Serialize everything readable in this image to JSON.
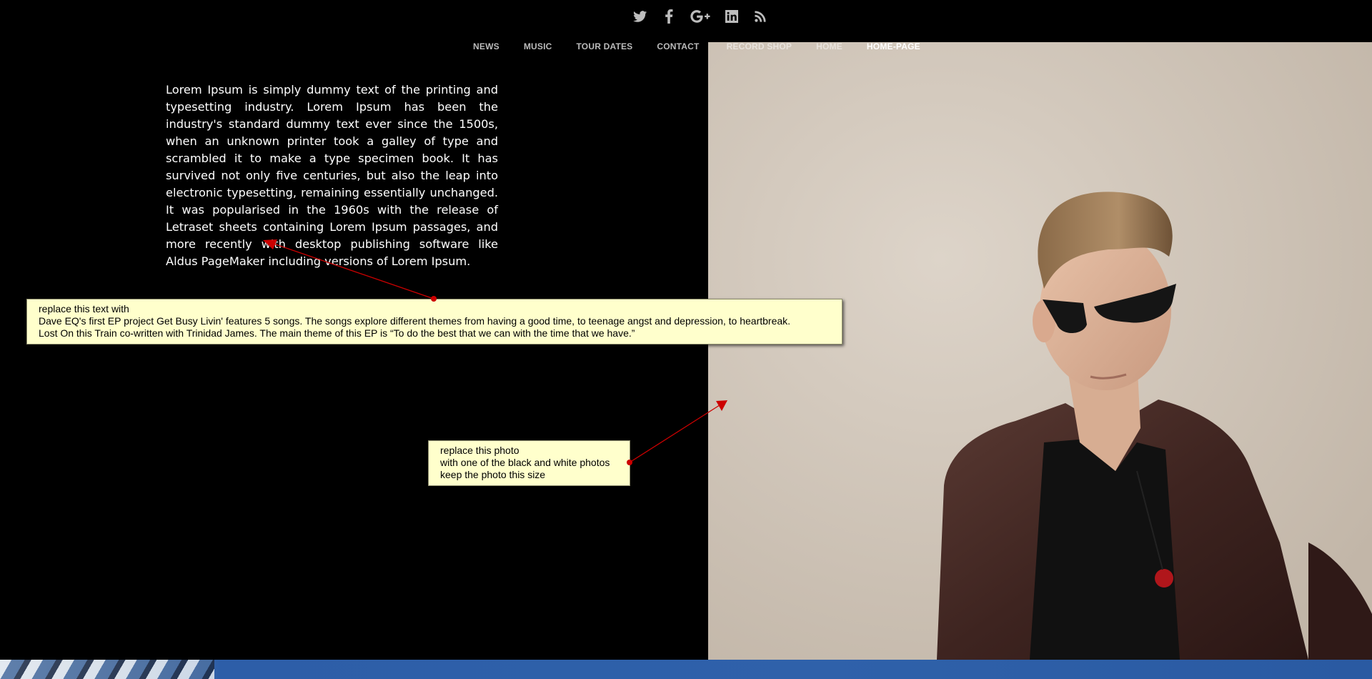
{
  "social": {
    "icons": [
      "twitter-icon",
      "facebook-icon",
      "google-plus-icon",
      "linkedin-icon",
      "rss-icon"
    ]
  },
  "nav": {
    "items": [
      {
        "label": "NEWS"
      },
      {
        "label": "MUSIC"
      },
      {
        "label": "TOUR DATES"
      },
      {
        "label": "CONTACT"
      },
      {
        "label": "RECORD SHOP"
      },
      {
        "label": "HOME"
      },
      {
        "label": "HOME-PAGE"
      }
    ]
  },
  "content": {
    "body_text": "Lorem Ipsum is simply dummy text of the printing and typesetting industry. Lorem Ipsum has been the industry's standard dummy text ever since the 1500s, when an unknown printer took a galley of type and scrambled it to make a type specimen book. It has survived not only five centuries, but also the leap into electronic typesetting, remaining essentially unchanged. It was popularised in the 1960s with the release of Letraset sheets containing Lorem Ipsum passages, and more recently with desktop publishing software like Aldus PageMaker including versions of Lorem Ipsum."
  },
  "annotations": {
    "text_note": {
      "line1": "replace this text with",
      "line2": "Dave EQ's first EP project Get Busy Livin' features 5 songs. The songs explore different themes from having a good time, to teenage angst and depression, to heartbreak.",
      "line3": "Lost On this Train co-written with Trinidad James. The main theme of this EP is “To do the best that we can with the time that we have.”"
    },
    "photo_note": {
      "line1": "replace this photo",
      "line2": "with one of the black and white photos",
      "line3": "keep the photo this size"
    }
  },
  "colors": {
    "background": "#000000",
    "note_background": "#ffffcc",
    "arrow": "#cc0000",
    "photo_backdrop": "#d4cabe"
  }
}
